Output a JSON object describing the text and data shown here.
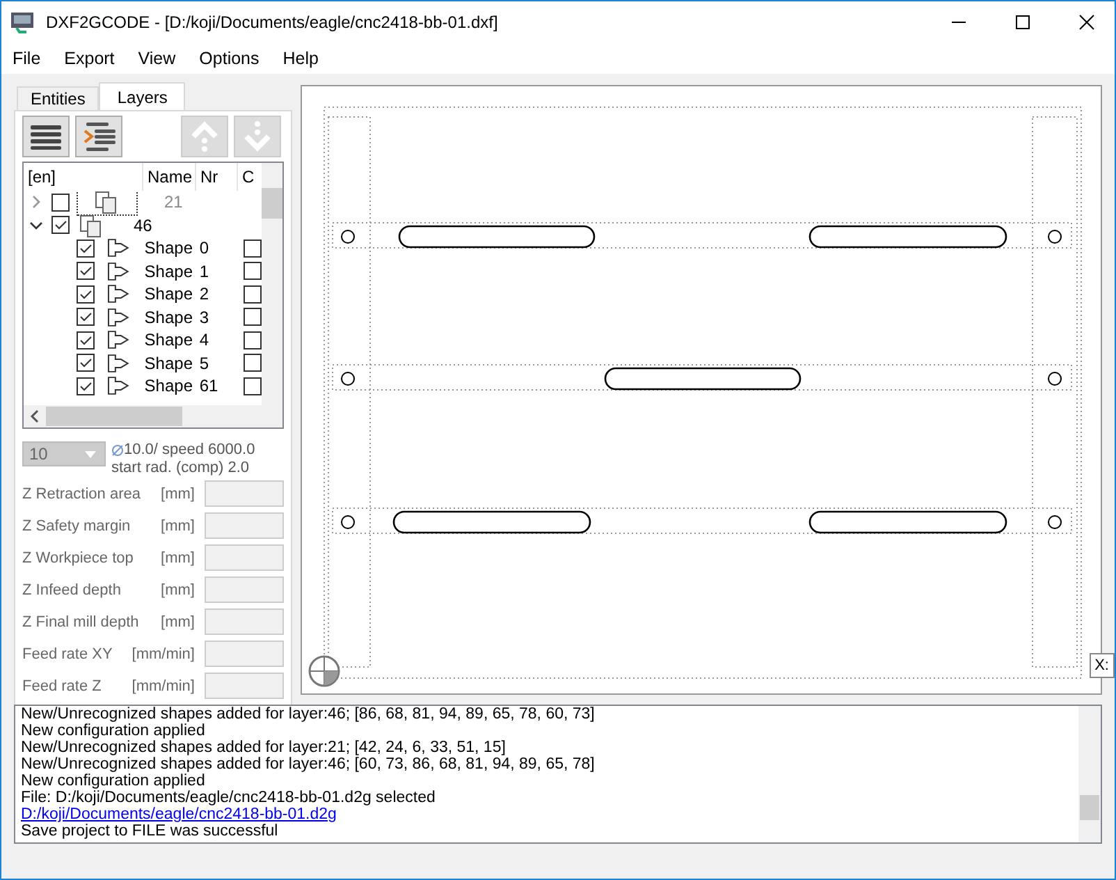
{
  "window": {
    "title": "DXF2GCODE - [D:/koji/Documents/eagle/cnc2418-bb-01.dxf]"
  },
  "menu": [
    "File",
    "Export",
    "View",
    "Options",
    "Help"
  ],
  "tabs": [
    {
      "label": "Entities",
      "selected": false
    },
    {
      "label": "Layers",
      "selected": true
    }
  ],
  "toolbar": [
    {
      "kind": "list",
      "disabled": false
    },
    {
      "kind": "indent",
      "disabled": false
    },
    {
      "kind": "up",
      "disabled": true
    },
    {
      "kind": "down",
      "disabled": true
    }
  ],
  "tree": {
    "columns": [
      "[en]",
      "Name",
      "Nr",
      "C"
    ],
    "layers": [
      {
        "name": "21",
        "checked": false,
        "expanded": false
      },
      {
        "name": "46",
        "checked": true,
        "expanded": true,
        "children": [
          {
            "name": "Shape",
            "nr": "0",
            "checked": true,
            "c_checked": false
          },
          {
            "name": "Shape",
            "nr": "1",
            "checked": true,
            "c_checked": false
          },
          {
            "name": "Shape",
            "nr": "2",
            "checked": true,
            "c_checked": false
          },
          {
            "name": "Shape",
            "nr": "3",
            "checked": true,
            "c_checked": false
          },
          {
            "name": "Shape",
            "nr": "4",
            "checked": true,
            "c_checked": false
          },
          {
            "name": "Shape",
            "nr": "5",
            "checked": true,
            "c_checked": false
          },
          {
            "name": "Shape",
            "nr": "61",
            "checked": true,
            "c_checked": false
          }
        ]
      }
    ]
  },
  "tool": {
    "selection": "10",
    "disabled": true,
    "info": "10.0/ speed 6000.0",
    "info2": "start rad. (comp)  2.0"
  },
  "params": [
    {
      "label": "Z Retraction area",
      "unit": "[mm]"
    },
    {
      "label": "Z Safety margin",
      "unit": "[mm]"
    },
    {
      "label": "Z Workpiece top",
      "unit": "[mm]"
    },
    {
      "label": "Z Infeed depth",
      "unit": "[mm]"
    },
    {
      "label": "Z Final mill depth",
      "unit": "[mm]"
    },
    {
      "label": "Feed rate XY",
      "unit": "[mm/min]"
    },
    {
      "label": "Feed rate Z",
      "unit": "[mm/min]"
    }
  ],
  "canvas": {
    "tooltip": "X:"
  },
  "log": [
    {
      "kind": "text",
      "text": "New/Unrecognized shapes added for layer:46; [86, 68, 81, 94, 89, 65, 78, 60, 73]"
    },
    {
      "kind": "text",
      "text": "New configuration applied"
    },
    {
      "kind": "text",
      "text": "New/Unrecognized shapes added for layer:21; [42, 24, 6, 33, 51, 15]"
    },
    {
      "kind": "text",
      "text": "New/Unrecognized shapes added for layer:46; [60, 73, 86, 68, 81, 94, 89, 65, 78]"
    },
    {
      "kind": "text",
      "text": "New configuration applied"
    },
    {
      "kind": "text",
      "text": "File: D:/koji/Documents/eagle/cnc2418-bb-01.d2g selected"
    },
    {
      "kind": "link",
      "text": "D:/koji/Documents/eagle/cnc2418-bb-01.d2g"
    },
    {
      "kind": "text",
      "text": "Save project to FILE was successful"
    }
  ]
}
